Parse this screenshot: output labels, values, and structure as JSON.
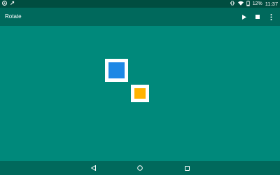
{
  "status_bar": {
    "battery": "12%",
    "time": "11:37",
    "icons": [
      "notification-icon",
      "link-icon",
      "vibrate-icon",
      "wifi-icon",
      "battery-icon"
    ]
  },
  "app_bar": {
    "title": "Rotate",
    "actions": [
      "play-icon",
      "stop-icon",
      "overflow-menu-icon"
    ]
  },
  "canvas": {
    "squares": [
      {
        "name": "blue-square",
        "color": "#1e88e5"
      },
      {
        "name": "orange-square",
        "color": "#ffb300"
      }
    ]
  },
  "nav_bar": {
    "buttons": [
      "back-icon",
      "home-icon",
      "recents-icon"
    ]
  },
  "colors": {
    "status_bar": "#004d40",
    "app_bar": "#00695c",
    "background": "#00897b"
  }
}
